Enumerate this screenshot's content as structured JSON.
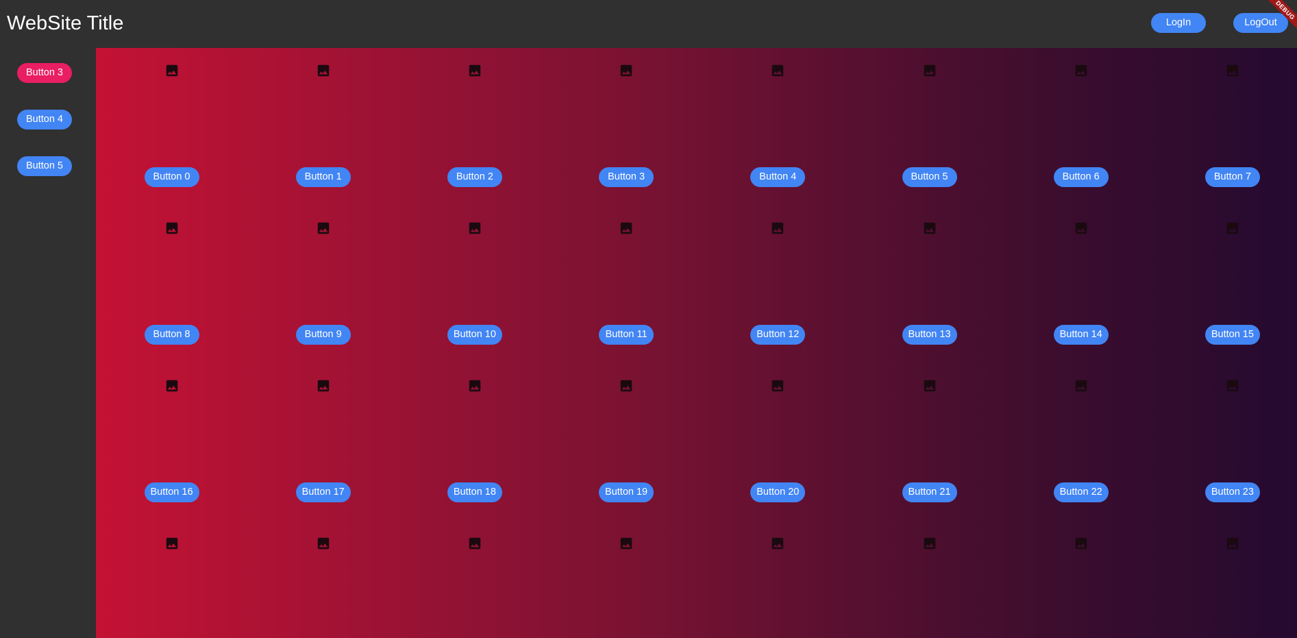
{
  "header": {
    "title": "WebSite Title",
    "login_label": "LogIn",
    "logout_label": "LogOut"
  },
  "debug_banner": "DEBUG",
  "sidebar": {
    "items": [
      {
        "label": "Button 3",
        "active": true
      },
      {
        "label": "Button 4",
        "active": false
      },
      {
        "label": "Button 5",
        "active": false
      }
    ]
  },
  "grid": {
    "columns": 8,
    "buttons": [
      "Button 0",
      "Button 1",
      "Button 2",
      "Button 3",
      "Button 4",
      "Button 5",
      "Button 6",
      "Button 7",
      "Button 8",
      "Button 9",
      "Button 10",
      "Button 11",
      "Button 12",
      "Button 13",
      "Button 14",
      "Button 15",
      "Button 16",
      "Button 17",
      "Button 18",
      "Button 19",
      "Button 20",
      "Button 21",
      "Button 22",
      "Button 23"
    ],
    "icon": "image-icon"
  },
  "colors": {
    "button_blue": "#4285f4",
    "button_active": "#e91e63",
    "background_dark": "#303030",
    "gradient_start": "#c41234",
    "gradient_end": "#250a30"
  }
}
